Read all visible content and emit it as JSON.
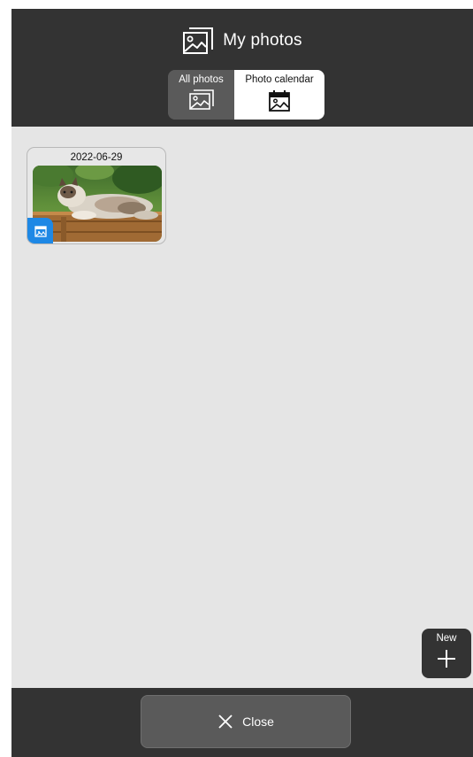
{
  "header": {
    "title": "My photos",
    "title_icon": "photos-stack-icon"
  },
  "view_toggle": {
    "options": [
      {
        "label": "All photos",
        "icon": "photo-icon",
        "selected": false
      },
      {
        "label": "Photo calendar",
        "icon": "calendar-photo-icon",
        "selected": true
      }
    ]
  },
  "photos": [
    {
      "date": "2022-06-29",
      "badge_icon": "calendar-photo-icon"
    }
  ],
  "new_button": {
    "label": "New",
    "icon": "plus-icon"
  },
  "footer": {
    "close_label": "Close",
    "close_icon": "close-x-icon"
  },
  "colors": {
    "header_bg": "#333333",
    "content_bg": "#e5e5e5",
    "button_bg": "#5a5a5a",
    "badge_blue": "#1e88e5"
  }
}
